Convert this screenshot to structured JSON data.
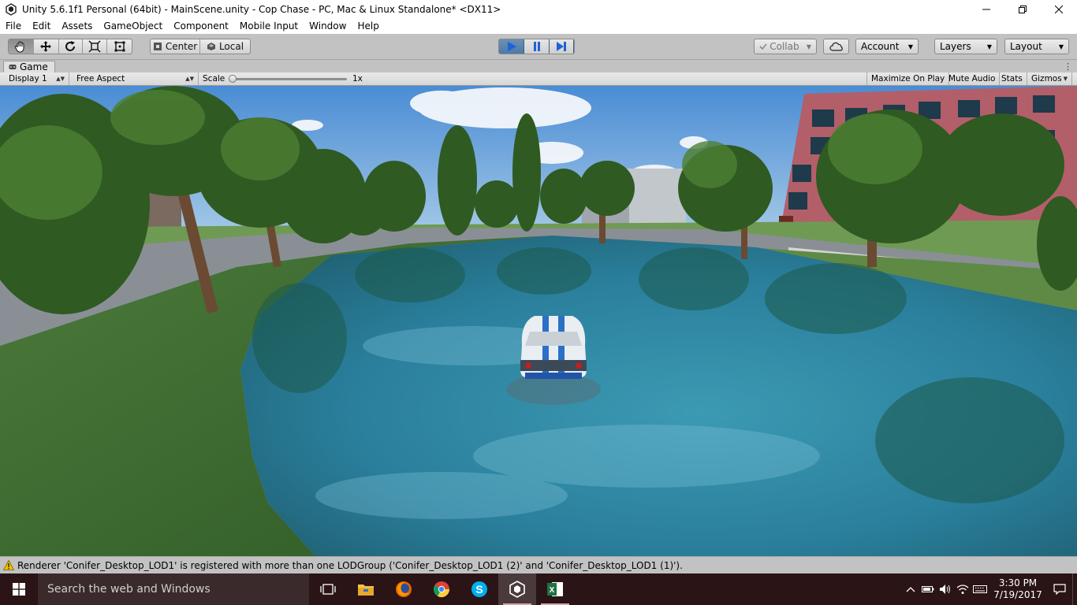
{
  "window": {
    "title": "Unity 5.6.1f1 Personal (64bit) - MainScene.unity - Cop Chase - PC, Mac & Linux Standalone* <DX11>",
    "minimize_icon": "minimize-icon",
    "maximize_icon": "restore-icon",
    "close_icon": "close-icon"
  },
  "menu": [
    "File",
    "Edit",
    "Assets",
    "GameObject",
    "Component",
    "Mobile Input",
    "Window",
    "Help"
  ],
  "toolbar": {
    "tools": [
      "hand-icon",
      "move-icon",
      "rotate-icon",
      "scale-icon",
      "rect-icon"
    ],
    "pivot_label": "Center",
    "space_label": "Local",
    "play_controls": [
      "play-icon",
      "pause-icon",
      "step-icon"
    ],
    "collab_label": "Collab",
    "account_label": "Account",
    "layers_label": "Layers",
    "layout_label": "Layout",
    "accent": "#4f79a8"
  },
  "game_tab": {
    "label": "Game"
  },
  "game_toolbar": {
    "display": "Display 1",
    "aspect": "Free Aspect",
    "scale_label": "Scale",
    "scale_value": "1x",
    "maximize_on_play": "Maximize On Play",
    "mute_audio": "Mute Audio",
    "stats": "Stats",
    "gizmos": "Gizmos"
  },
  "status": {
    "message": "Renderer 'Conifer_Desktop_LOD1' is registered with more than one LODGroup ('Conifer_Desktop_LOD1 (2)' and 'Conifer_Desktop_LOD1 (1)').",
    "icon": "warning-icon"
  },
  "taskbar": {
    "search_placeholder": "Search the web and Windows",
    "apps": [
      "task-view-icon",
      "file-explorer-icon",
      "firefox-icon",
      "chrome-icon",
      "skype-icon",
      "unity-icon",
      "excel-icon"
    ],
    "time": "3:30 PM",
    "date": "7/19/2017"
  }
}
